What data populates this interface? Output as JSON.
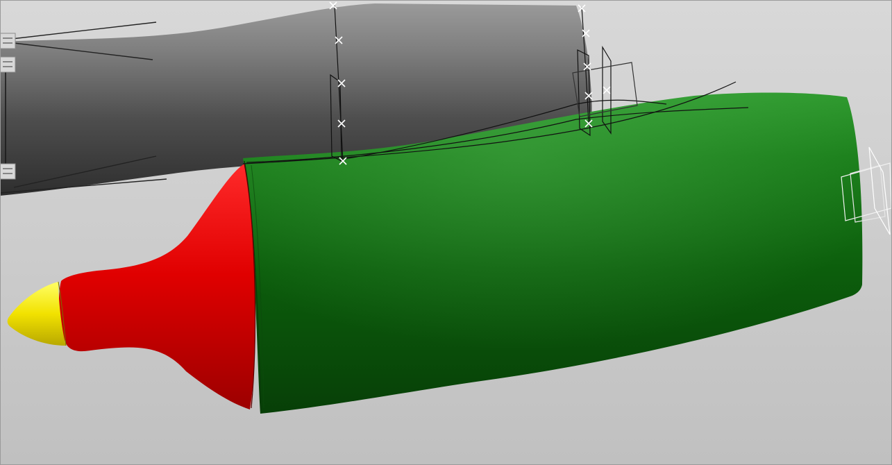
{
  "viewport": {
    "background_top": "#d6d6d6",
    "background_bottom": "#c2c2c2"
  },
  "model": {
    "parts": [
      {
        "name": "nose-tip",
        "color": "#ffe600"
      },
      {
        "name": "front-cone",
        "color": "#e30000"
      },
      {
        "name": "body-shell",
        "color": "#157515"
      },
      {
        "name": "reference-body",
        "color": "#5a5a5a"
      }
    ],
    "wireframe_color": "#111111",
    "control_point_color": "#ffffff",
    "control_point_glyph": "x-mark"
  }
}
